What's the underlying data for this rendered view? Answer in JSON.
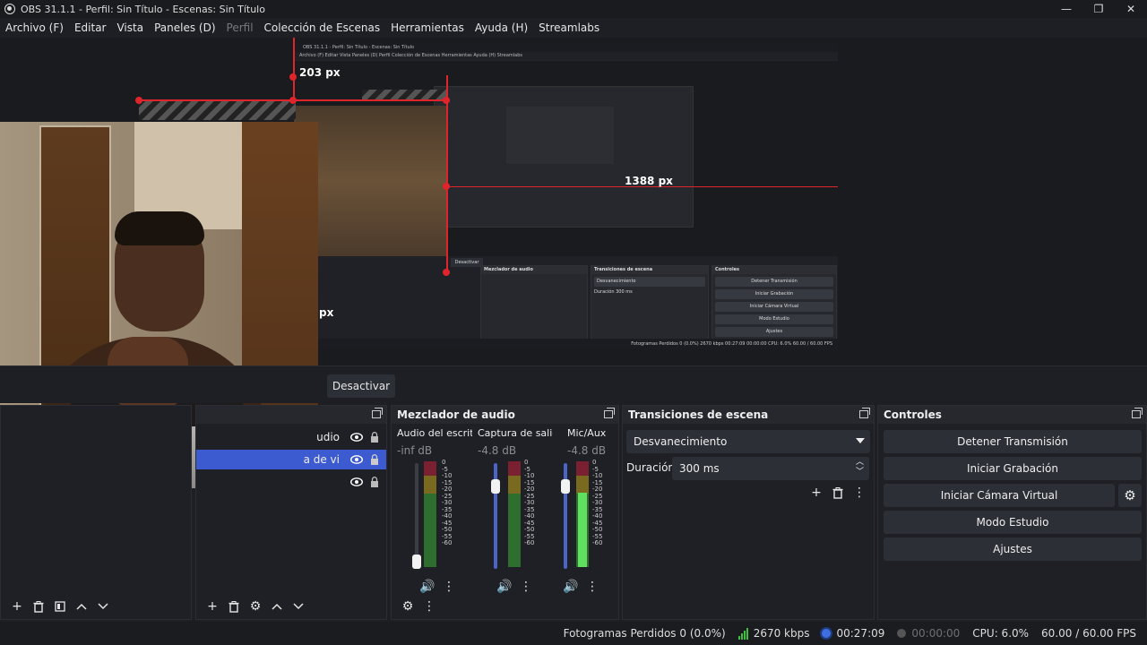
{
  "window": {
    "title": "OBS 31.1.1 - Perfil: Sin Título - Escenas: Sin Título",
    "minimize": "—",
    "maximize": "❐",
    "close": "✕"
  },
  "menu": {
    "items": [
      "Archivo (F)",
      "Editar",
      "Vista",
      "Paneles (D)",
      "Perfil",
      "Colección de Escenas",
      "Herramientas",
      "Ayuda (H)",
      "Streamlabs"
    ]
  },
  "preview": {
    "top_label": "203 px",
    "right_label": "1388 px",
    "partial_label": "px",
    "mini_title": "OBS 31.1.1 - Perfil: Sin Título - Escenas: Sin Título",
    "mini_menu": "Archivo (F)   Editar   Vista   Paneles (D)   Perfil   Colección de Escenas   Herramientas   Ayuda (H)   Streamlabs",
    "mini_desactivar": "Desactivar",
    "mini_mixer": "Mezclador de audio",
    "mini_transitions": "Transiciones de escena",
    "mini_controls": "Controles",
    "mini_transition_value": "Desvanecimiento",
    "mini_duration_label": "Duración",
    "mini_duration_value": "300 ms",
    "mini_buttons": [
      "Detener Transmisión",
      "Iniciar Grabación",
      "Iniciar Cámara Virtual",
      "Modo Estudio",
      "Ajustes"
    ],
    "mini_status": "Fotogramas Perdidos 0 (0.0%)    2670 kbps    00:27:09    00:00:00    CPU: 6.0%    60.00 / 60.00 FPS"
  },
  "toolbar_strip": {
    "desactivar": "Desactivar"
  },
  "sources": {
    "rows": [
      {
        "label": "udio",
        "selected": false
      },
      {
        "label": "a de vi",
        "selected": true
      },
      {
        "label": "",
        "selected": false
      }
    ]
  },
  "mixer": {
    "title": "Mezclador de audio",
    "channels": [
      {
        "name": "Audio del escritoric",
        "db": "-inf dB",
        "level": 0.0,
        "muted_slider": true
      },
      {
        "name": "Captura de salida d",
        "db": "-4.8 dB",
        "level": 0.0,
        "muted_slider": false
      },
      {
        "name": "Mic/Aux",
        "db": "-4.8 dB",
        "level": 0.7,
        "muted_slider": false
      }
    ],
    "scale": [
      "0",
      "-5",
      "-10",
      "-15",
      "-20",
      "-25",
      "-30",
      "-35",
      "-40",
      "-45",
      "-50",
      "-55",
      "-60"
    ]
  },
  "transitions": {
    "title": "Transiciones de escena",
    "selected": "Desvanecimiento",
    "duration_label": "Duración",
    "duration_value": "300 ms"
  },
  "controls": {
    "title": "Controles",
    "buttons": [
      "Detener Transmisión",
      "Iniciar Grabación",
      "Iniciar Cámara Virtual",
      "Modo Estudio",
      "Ajustes"
    ]
  },
  "status": {
    "dropped": "Fotogramas Perdidos 0 (0.0%)",
    "bitrate": "2670 kbps",
    "stream_time": "00:27:09",
    "rec_time": "00:00:00",
    "cpu": "CPU: 6.0%",
    "fps": "60.00 / 60.00 FPS"
  },
  "colors": {
    "accent": "#3d5bd0",
    "live": "#3d6fe0",
    "guide": "#e0242b"
  }
}
